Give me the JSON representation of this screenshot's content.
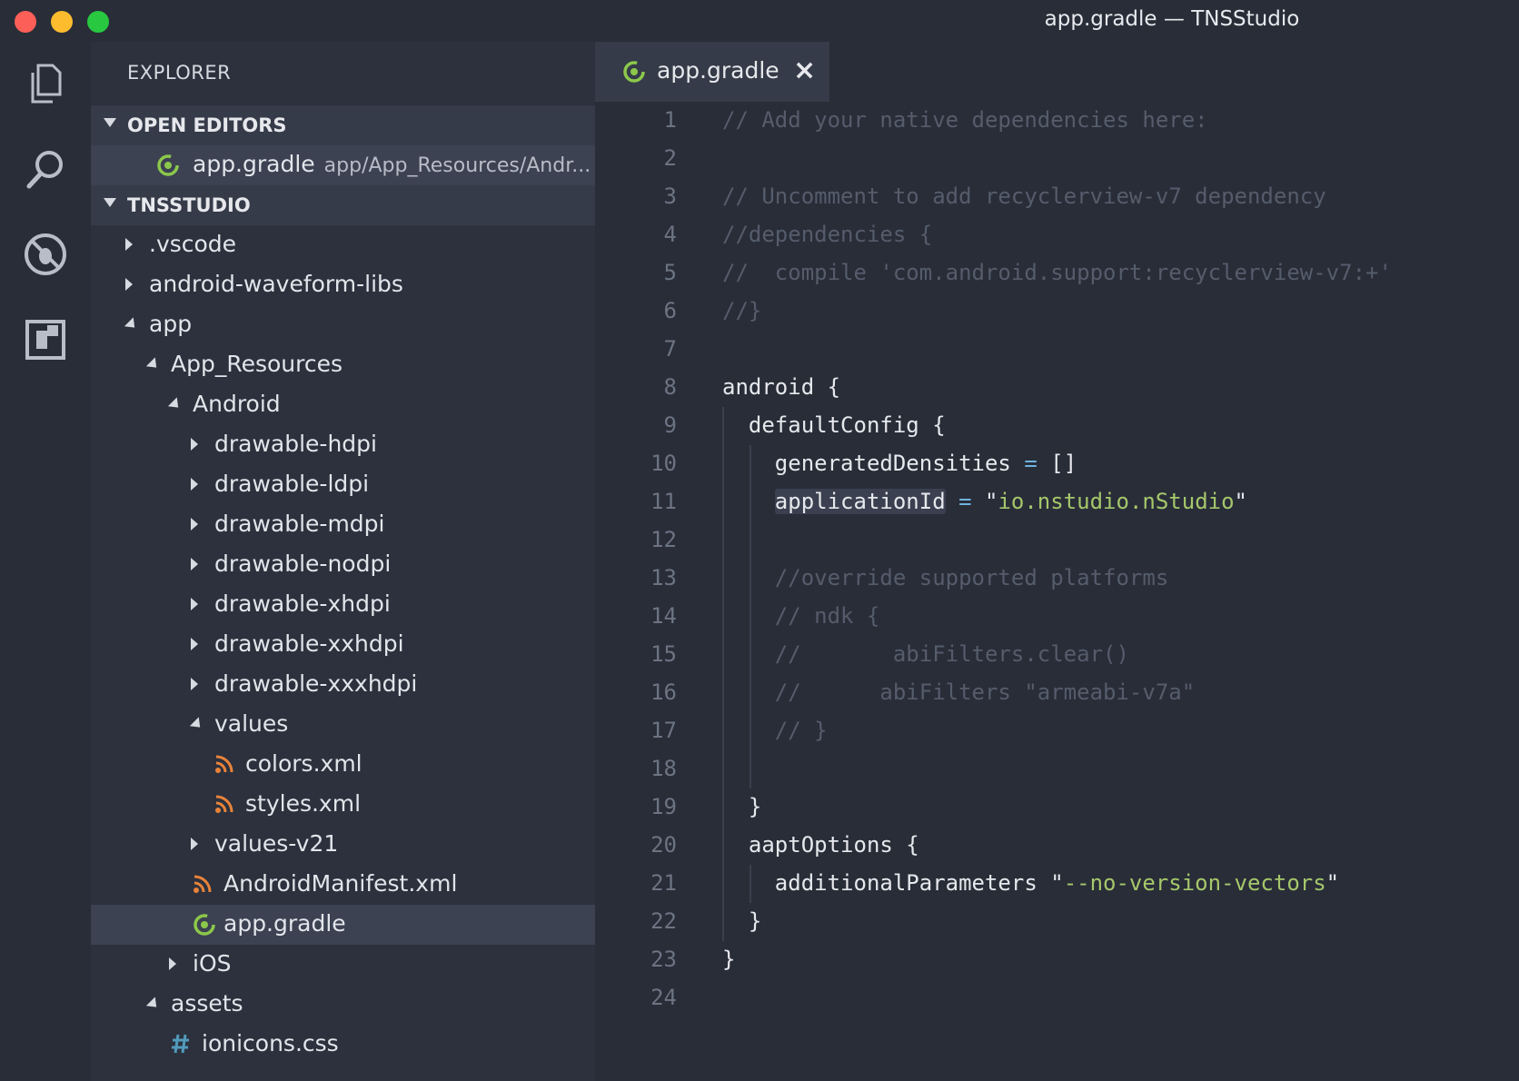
{
  "window": {
    "title": "app.gradle — TNSStudio"
  },
  "activity_bar": [
    "files-icon",
    "search-icon",
    "debug-icon",
    "extensions-icon"
  ],
  "sidebar": {
    "title": "EXPLORER",
    "open_editors": {
      "label": "OPEN EDITORS",
      "items": [
        {
          "name": "app.gradle",
          "path": "app/App_Resources/Andr..."
        }
      ]
    },
    "project": {
      "label": "TNSSTUDIO",
      "tree": [
        {
          "label": ".vscode",
          "depth": 0,
          "kind": "folder",
          "open": false
        },
        {
          "label": "android-waveform-libs",
          "depth": 0,
          "kind": "folder",
          "open": false
        },
        {
          "label": "app",
          "depth": 0,
          "kind": "folder",
          "open": true
        },
        {
          "label": "App_Resources",
          "depth": 1,
          "kind": "folder",
          "open": true
        },
        {
          "label": "Android",
          "depth": 2,
          "kind": "folder",
          "open": true
        },
        {
          "label": "drawable-hdpi",
          "depth": 3,
          "kind": "folder",
          "open": false
        },
        {
          "label": "drawable-ldpi",
          "depth": 3,
          "kind": "folder",
          "open": false
        },
        {
          "label": "drawable-mdpi",
          "depth": 3,
          "kind": "folder",
          "open": false
        },
        {
          "label": "drawable-nodpi",
          "depth": 3,
          "kind": "folder",
          "open": false
        },
        {
          "label": "drawable-xhdpi",
          "depth": 3,
          "kind": "folder",
          "open": false
        },
        {
          "label": "drawable-xxhdpi",
          "depth": 3,
          "kind": "folder",
          "open": false
        },
        {
          "label": "drawable-xxxhdpi",
          "depth": 3,
          "kind": "folder",
          "open": false
        },
        {
          "label": "values",
          "depth": 3,
          "kind": "folder",
          "open": true
        },
        {
          "label": "colors.xml",
          "depth": 4,
          "kind": "xml"
        },
        {
          "label": "styles.xml",
          "depth": 4,
          "kind": "xml"
        },
        {
          "label": "values-v21",
          "depth": 3,
          "kind": "folder",
          "open": false
        },
        {
          "label": "AndroidManifest.xml",
          "depth": 3,
          "kind": "xml"
        },
        {
          "label": "app.gradle",
          "depth": 3,
          "kind": "gradle",
          "selected": true
        },
        {
          "label": "iOS",
          "depth": 2,
          "kind": "folder",
          "open": false
        },
        {
          "label": "assets",
          "depth": 1,
          "kind": "folder",
          "open": true
        },
        {
          "label": "ionicons.css",
          "depth": 2,
          "kind": "css"
        }
      ]
    }
  },
  "editor": {
    "tab": {
      "label": "app.gradle",
      "close": "×"
    },
    "lines": [
      [
        [
          "cmt",
          "// Add your native dependencies here:"
        ]
      ],
      [],
      [
        [
          "cmt",
          "// Uncomment to add recyclerview-v7 dependency"
        ]
      ],
      [
        [
          "cmt",
          "//dependencies {"
        ]
      ],
      [
        [
          "cmt",
          "//  compile 'com.android.support:recyclerview-v7:+'"
        ]
      ],
      [
        [
          "cmt",
          "//}"
        ]
      ],
      [],
      [
        [
          "txt",
          "android {"
        ]
      ],
      [
        [
          "txt",
          "  defaultConfig {"
        ]
      ],
      [
        [
          "txt",
          "    generatedDensities "
        ],
        [
          "op",
          "="
        ],
        [
          "txt",
          " []"
        ]
      ],
      [
        [
          "txt",
          "    "
        ],
        [
          "hl",
          "applicationId"
        ],
        [
          "txt",
          " "
        ],
        [
          "op",
          "="
        ],
        [
          "txt",
          " \""
        ],
        [
          "str",
          "io.nstudio.nStudio"
        ],
        [
          "txt",
          "\""
        ]
      ],
      [],
      [
        [
          "txt",
          "    "
        ],
        [
          "cmt",
          "//override supported platforms"
        ]
      ],
      [
        [
          "txt",
          "    "
        ],
        [
          "cmt",
          "// ndk {"
        ]
      ],
      [
        [
          "txt",
          "    "
        ],
        [
          "cmt",
          "//       abiFilters.clear()"
        ]
      ],
      [
        [
          "txt",
          "    "
        ],
        [
          "cmt",
          "//      abiFilters \"armeabi-v7a\""
        ]
      ],
      [
        [
          "txt",
          "    "
        ],
        [
          "cmt",
          "// }"
        ]
      ],
      [],
      [
        [
          "txt",
          "  }"
        ]
      ],
      [
        [
          "txt",
          "  aaptOptions {"
        ]
      ],
      [
        [
          "txt",
          "    additionalParameters \""
        ],
        [
          "str",
          "--no-version-vectors"
        ],
        [
          "txt",
          "\""
        ]
      ],
      [
        [
          "txt",
          "  }"
        ]
      ],
      [
        [
          "txt",
          "}"
        ]
      ],
      []
    ]
  },
  "colors": {
    "accent_gradle": "#8cc84b",
    "xml": "#e8833a",
    "css": "#519aba"
  }
}
